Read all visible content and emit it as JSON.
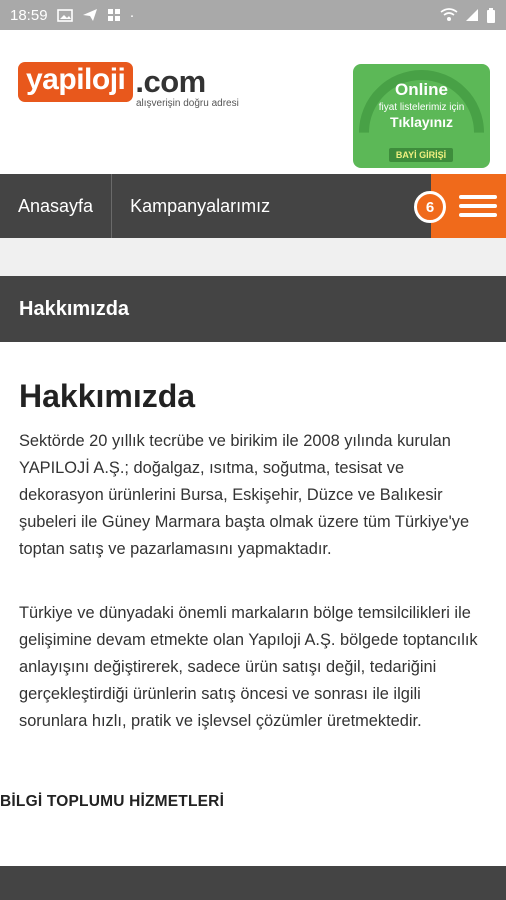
{
  "status_bar": {
    "time": "18:59",
    "dot": "·",
    "icons": [
      "image-icon",
      "send-icon",
      "grid-icon",
      "wifi-icon",
      "signal-icon",
      "battery-icon"
    ]
  },
  "header": {
    "logo_main": "yapiloji",
    "logo_suffix": ".com",
    "logo_tagline": "alışverişin doğru adresi",
    "promo": {
      "title": "Online",
      "subtitle": "fiyat listelerimiz için",
      "cta": "Tıklayınız",
      "button": "BAYİ GİRİŞİ"
    }
  },
  "nav": {
    "items": [
      {
        "label": "Anasayfa"
      },
      {
        "label": "Kampanyalarımız"
      }
    ],
    "badge_count": "6"
  },
  "section": {
    "bar_title": "Hakkımızda"
  },
  "content": {
    "heading": "Hakkımızda",
    "paragraphs": [
      "Sektörde 20 yıllık tecrübe ve birikim ile 2008 yılında kurulan YAPILOJİ A.Ş.; doğalgaz, ısıtma, soğutma, tesisat ve dekorasyon ürünlerini Bursa, Eskişehir, Düzce ve Balıkesir şubeleri ile Güney Marmara başta olmak üzere tüm Türkiye'ye toptan satış ve pazarlamasını yapmaktadır.",
      "Türkiye ve dünyadaki önemli markaların bölge temsilcilikleri ile gelişimine devam etmekte olan Yapıloji A.Ş. bölgede toptancılık anlayışını değiştirerek, sadece ürün satışı değil, tedariğini gerçekleştirdiği ürünlerin satış öncesi ve sonrası ile ilgili sorunlara hızlı, pratik ve işlevsel çözümler üretmektedir."
    ],
    "footer_link": "BİLGİ TOPLUMU HİZMETLERİ"
  },
  "colors": {
    "accent": "#f06a1b",
    "logo_orange": "#e8581c",
    "nav_bg": "#444444",
    "promo_green": "#5cb857",
    "status_bar": "#a9a9a9"
  }
}
